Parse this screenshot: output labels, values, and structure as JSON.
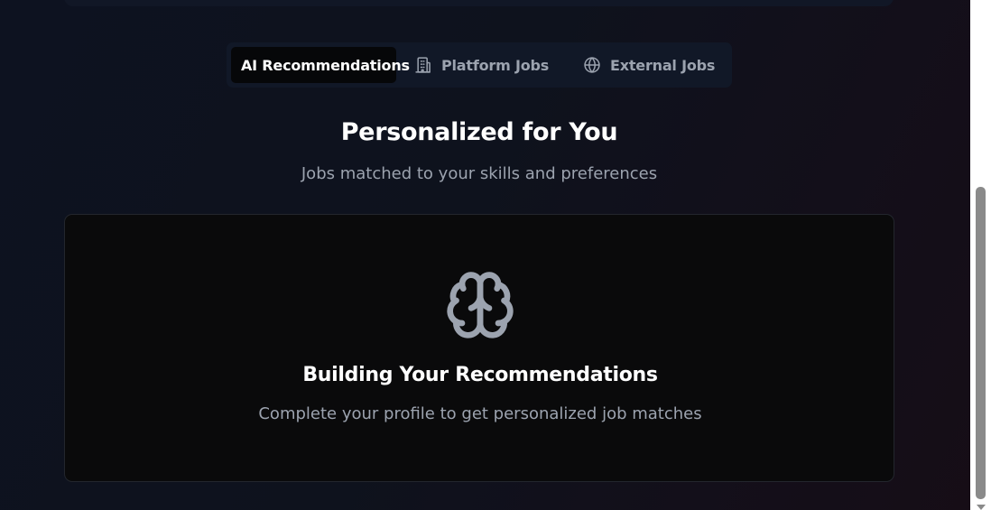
{
  "tabs": [
    {
      "label": "AI Recommendations",
      "icon": "sparkle-icon",
      "active": true
    },
    {
      "label": "Platform Jobs",
      "icon": "building-icon",
      "active": false
    },
    {
      "label": "External Jobs",
      "icon": "globe-icon",
      "active": false
    }
  ],
  "section": {
    "title": "Personalized for You",
    "subtitle": "Jobs matched to your skills and preferences"
  },
  "empty_state": {
    "icon": "brain-icon",
    "title": "Building Your Recommendations",
    "message": "Complete your profile to get personalized job matches"
  },
  "colors": {
    "background": "#0e121d",
    "tab_bar": "#111827",
    "active_tab": "#060709",
    "card": "#0a0a0b",
    "muted_text": "#9ca3af",
    "icon": "#9ca3af"
  }
}
